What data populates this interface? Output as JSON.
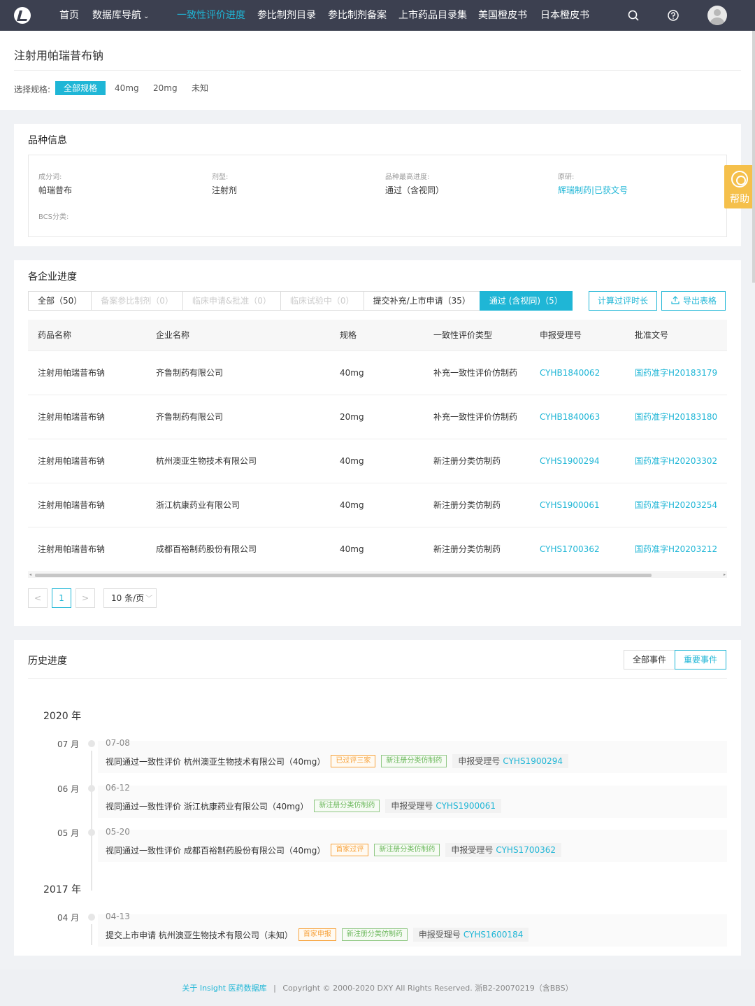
{
  "nav": {
    "items": [
      "首页",
      "数据库导航",
      "一致性评价进度",
      "参比制剂目录",
      "参比制剂备案",
      "上市药品目录集",
      "美国橙皮书",
      "日本橙皮书"
    ],
    "active": "一致性评价进度",
    "caret": "⌄"
  },
  "header": {
    "title": "注射用帕瑞昔布钠",
    "spec_label": "选择规格:",
    "spec_options": [
      "全部规格",
      "40mg",
      "20mg",
      "未知"
    ]
  },
  "variety": {
    "title": "品种信息",
    "fields": [
      {
        "label": "成分词:",
        "value": "帕瑞昔布"
      },
      {
        "label": "剂型:",
        "value": "注射剂"
      },
      {
        "label": "品种最高进度:",
        "value": "通过（含视同）"
      },
      {
        "label": "原研:",
        "value": "辉瑞制药|已获文号"
      },
      {
        "label": "BCS分类:",
        "value": ""
      }
    ]
  },
  "help": {
    "label": "帮助"
  },
  "progress": {
    "title": "各企业进度",
    "tabs": [
      "全部（50）",
      "备案参比制剂（0）",
      "临床申请&批准（0）",
      "临床试验中（0）",
      "提交补充/上市申请（35）",
      "通过 (含视同)（5）"
    ],
    "calc_button": "计算过评时长",
    "export_button": "导出表格",
    "columns": [
      "药品名称",
      "企业名称",
      "规格",
      "一致性评价类型",
      "申报受理号",
      "批准文号"
    ],
    "rows": [
      [
        "注射用帕瑞昔布钠",
        "齐鲁制药有限公司",
        "40mg",
        "补充一致性评价仿制药",
        "CYHB1840062",
        "国药准字H20183179"
      ],
      [
        "注射用帕瑞昔布钠",
        "齐鲁制药有限公司",
        "20mg",
        "补充一致性评价仿制药",
        "CYHB1840063",
        "国药准字H20183180"
      ],
      [
        "注射用帕瑞昔布钠",
        "杭州澳亚生物技术有限公司",
        "40mg",
        "新注册分类仿制药",
        "CYHS1900294",
        "国药准字H20203302"
      ],
      [
        "注射用帕瑞昔布钠",
        "浙江杭康药业有限公司",
        "40mg",
        "新注册分类仿制药",
        "CYHS1900061",
        "国药准字H20203254"
      ],
      [
        "注射用帕瑞昔布钠",
        "成都百裕制药股份有限公司",
        "40mg",
        "新注册分类仿制药",
        "CYHS1700362",
        "国药准字H20203212"
      ]
    ],
    "pagination": {
      "prev": "<",
      "current": "1",
      "next": ">",
      "page_size": "10 条/页"
    }
  },
  "history": {
    "title": "历史进度",
    "filter_all": "全部事件",
    "filter_important": "重要事件",
    "code_prefix": "申报受理号",
    "years": [
      "2020 年",
      "2017 年"
    ],
    "events": [
      {
        "month": "07 月",
        "date": "07-08",
        "text": "视同通过一致性评价 杭州澳亚生物技术有限公司（40mg）",
        "tags": [
          {
            "t": "已过评三家",
            "c": "orange"
          },
          {
            "t": "新注册分类仿制药",
            "c": "green"
          }
        ],
        "code": "CYHS1900294"
      },
      {
        "month": "06 月",
        "date": "06-12",
        "text": "视同通过一致性评价 浙江杭康药业有限公司（40mg）",
        "tags": [
          {
            "t": "新注册分类仿制药",
            "c": "green"
          }
        ],
        "code": "CYHS1900061"
      },
      {
        "month": "05 月",
        "date": "05-20",
        "text": "视同通过一致性评价 成都百裕制药股份有限公司（40mg）",
        "tags": [
          {
            "t": "首家过评",
            "c": "orange"
          },
          {
            "t": "新注册分类仿制药",
            "c": "green"
          }
        ],
        "code": "CYHS1700362"
      },
      {
        "month": "04 月",
        "date": "04-13",
        "text": "提交上市申请 杭州澳亚生物技术有限公司（未知）",
        "tags": [
          {
            "t": "首家申报",
            "c": "orange"
          },
          {
            "t": "新注册分类仿制药",
            "c": "green"
          }
        ],
        "code": "CYHS1600184"
      }
    ]
  },
  "footer": {
    "link": "关于 Insight 医药数据库",
    "separator": "|",
    "copyright": "Copyright © 2000-2020 DXY All Rights Reserved. 浙B2-20070219（含BBS）"
  },
  "colors": {
    "accent": "#1fb6d6",
    "nav_bg": "#3c4050",
    "help": "#f5c04b",
    "tag_orange": "#f7a23b",
    "tag_green": "#6bb85b"
  },
  "icons": [
    "logo-icon",
    "search-icon",
    "help-circle-icon",
    "avatar-icon",
    "customer-service-icon",
    "upload-icon"
  ]
}
